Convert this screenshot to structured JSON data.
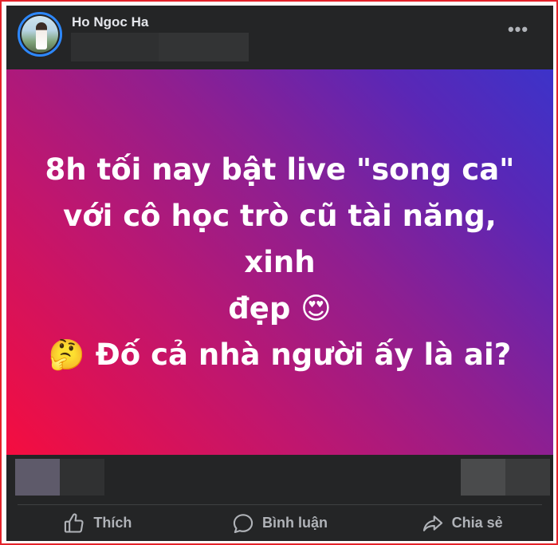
{
  "post": {
    "author": "Ho Ngoc Ha",
    "lines": [
      "8h tối nay bật live \"song ca\"",
      "với cô học trò cũ tài năng, xinh",
      "đẹp 😍",
      "🤔 Đố cả nhà người ấy là ai?"
    ]
  },
  "actions": {
    "like": "Thích",
    "comment": "Bình luận",
    "share": "Chia sẻ"
  },
  "icons": {
    "more": "more-options-icon",
    "like": "thumbs-up-icon",
    "comment": "comment-bubble-icon",
    "share": "share-arrow-icon"
  },
  "colors": {
    "card_background": "#242526",
    "text_primary": "#e4e6eb",
    "text_secondary": "#b0b3b8",
    "gradient_start": "#f50d3f",
    "gradient_end": "#3c33c9",
    "frame_border": "#e3232a"
  }
}
